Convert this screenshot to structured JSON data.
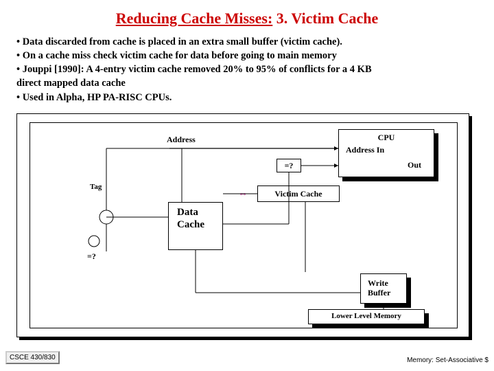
{
  "title_underlined": "Reducing Cache Misses:",
  "title_rest": " 3. Victim Cache",
  "bullets": [
    "•  Data discarded from cache is placed  in an extra small buffer (victim cache).",
    "•  On a cache miss check victim cache for data before going to main memory",
    "•  Jouppi [1990]:  A 4-entry victim cache removed 20% to 95% of conflicts for a 4 KB",
    "direct mapped data cache",
    "•  Used in Alpha, HP PA-RISC  CPUs."
  ],
  "diagram": {
    "address_label": "Address",
    "tag_label": "Tag",
    "eq1": "=?",
    "eq2": "=?",
    "cpu_label": "CPU",
    "address_in_label": "Address In",
    "out_label": "Out",
    "victim_cache_label": "Victim Cache",
    "data_cache_line1": "Data",
    "data_cache_line2": "Cache",
    "write_buffer_line1": "Write",
    "write_buffer_line2": "Buffer",
    "lower_mem_label": "Lower Level Memory"
  },
  "footer_left": "CSCE 430/830",
  "footer_right": "Memory: Set-Associative $"
}
